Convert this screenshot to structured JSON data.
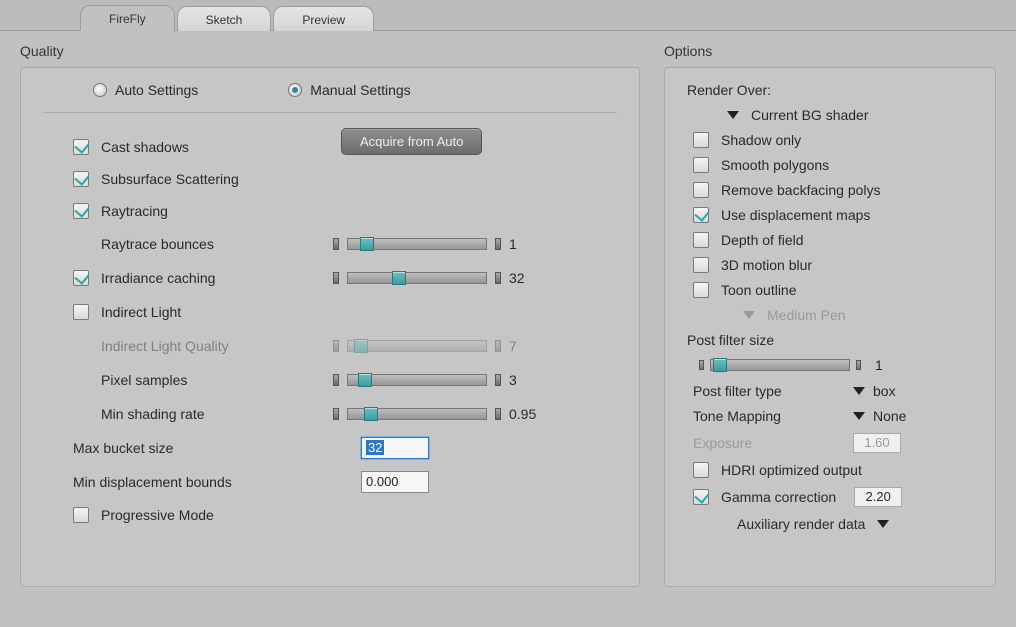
{
  "tabs": [
    "FireFly",
    "Sketch",
    "Preview"
  ],
  "quality": {
    "title": "Quality",
    "auto_label": "Auto Settings",
    "manual_label": "Manual Settings",
    "acquire_btn": "Acquire from Auto",
    "cast_shadows": "Cast shadows",
    "subsurface": "Subsurface Scattering",
    "raytracing": "Raytracing",
    "raytrace_bounces": {
      "label": "Raytrace bounces",
      "value": "1"
    },
    "irradiance": {
      "label": "Irradiance caching",
      "value": "32"
    },
    "indirect_light": "Indirect Light",
    "indirect_quality": {
      "label": "Indirect Light Quality",
      "value": "7"
    },
    "pixel_samples": {
      "label": "Pixel samples",
      "value": "3"
    },
    "min_shading": {
      "label": "Min shading rate",
      "value": "0.95"
    },
    "max_bucket": {
      "label": "Max bucket size",
      "value": "32"
    },
    "min_disp": {
      "label": "Min displacement bounds",
      "value": "0.000"
    },
    "progressive": "Progressive Mode"
  },
  "options": {
    "title": "Options",
    "render_over": "Render Over:",
    "bg_shader": "Current BG shader",
    "shadow_only": "Shadow only",
    "smooth_polygons": "Smooth polygons",
    "remove_backfacing": "Remove backfacing polys",
    "use_displacement": "Use displacement maps",
    "depth_of_field": "Depth of field",
    "motion_blur": "3D motion blur",
    "toon_outline": "Toon outline",
    "medium_pen": "Medium Pen",
    "post_filter_size": {
      "label": "Post filter size",
      "value": "1"
    },
    "post_filter_type": {
      "label": "Post filter type",
      "value": "box"
    },
    "tone_mapping": {
      "label": "Tone Mapping",
      "value": "None"
    },
    "exposure": {
      "label": "Exposure",
      "value": "1.60"
    },
    "hdri": "HDRI optimized output",
    "gamma": {
      "label": "Gamma correction",
      "value": "2.20"
    },
    "aux": "Auxiliary render data"
  }
}
